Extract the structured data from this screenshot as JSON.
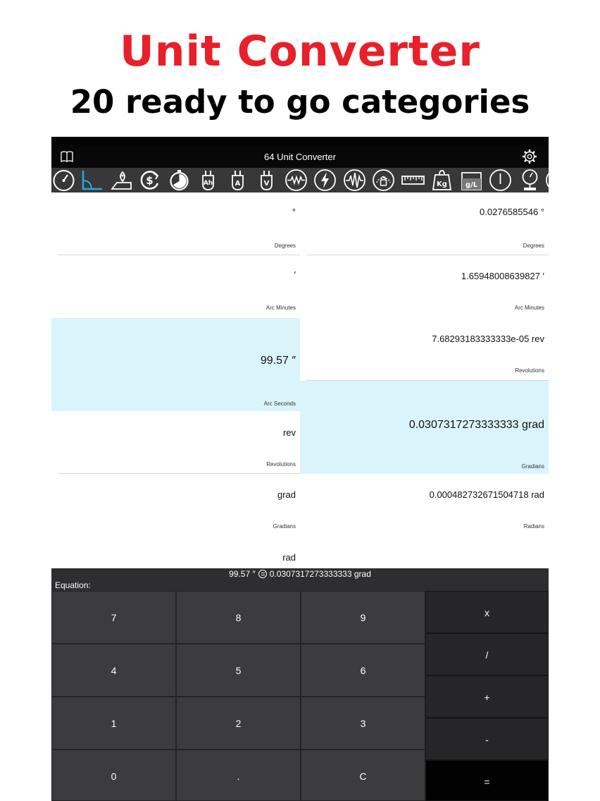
{
  "promo": {
    "title": "Unit Converter",
    "subtitle": "20 ready to go categories"
  },
  "navbar": {
    "title": "64 Unit Converter"
  },
  "categories": [
    "speed-icon",
    "angle-icon",
    "distance-icon",
    "currency-icon",
    "time-icon",
    "amp-hour-icon",
    "ampere-icon",
    "volt-icon",
    "resistance-icon",
    "power-icon",
    "frequency-icon",
    "pressure-icon",
    "length-icon",
    "weight-icon",
    "concentration-icon",
    "on-off-icon",
    "gauge-icon"
  ],
  "colors": {
    "accent": "#29a8e0",
    "selected_bg": "#daf4fb",
    "promo_red": "#e8202a"
  },
  "left_units": [
    {
      "value": "°",
      "unit": "Degrees"
    },
    {
      "value": "′",
      "unit": "Arc Minutes"
    },
    {
      "value": "99.57 ″",
      "unit": "Arc Seconds"
    },
    {
      "value": "rev",
      "unit": "Revolutions"
    },
    {
      "value": "grad",
      "unit": "Gradians"
    },
    {
      "value": "rad",
      "unit": ""
    }
  ],
  "right_units": [
    {
      "value": "0.0276585546 °",
      "unit": "Degrees"
    },
    {
      "value": "1.65948008639827 ′",
      "unit": "Arc Minutes"
    },
    {
      "value": "7.68293183333333e-05 rev",
      "unit": "Revolutions"
    },
    {
      "value": "0.0307317273333333 grad",
      "unit": "Gradians"
    },
    {
      "value": "0.000482732671504718 rad",
      "unit": "Radians"
    }
  ],
  "equation": {
    "left": "99.57 ″",
    "right": "0.0307317273333333 grad",
    "label": "Equation:"
  },
  "keypad": {
    "digits": [
      "7",
      "8",
      "9",
      "4",
      "5",
      "6",
      "1",
      "2",
      "3",
      "0",
      ".",
      "C"
    ],
    "operators": [
      "x",
      "/",
      "+",
      "-",
      "="
    ]
  }
}
